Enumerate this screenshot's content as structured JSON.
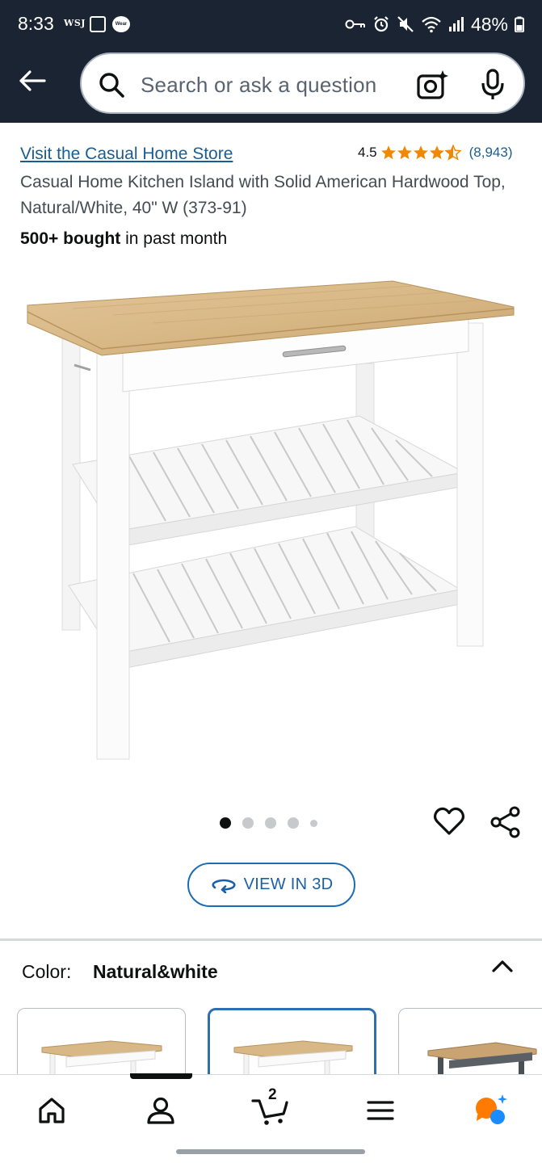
{
  "status_bar": {
    "time": "8:33",
    "app_badge": "WSJ",
    "wear_badge": "Wear",
    "battery": "48%"
  },
  "search": {
    "placeholder": "Search or ask a question"
  },
  "product": {
    "store_link": "Visit the Casual Home Store",
    "rating_value": "4.5",
    "rating_stars": 4.5,
    "rating_count": "(8,943)",
    "title": "Casual Home Kitchen Island with Solid American Hardwood Top, Natural/White, 40\" W (373-91)",
    "bought_bold": "500+ bought",
    "bought_rest": " in past month",
    "image_count": 5,
    "active_image": 1
  },
  "actions": {
    "view_3d_label": "VIEW IN 3D"
  },
  "variation": {
    "label": "Color:",
    "value": "Natural&white"
  },
  "bottom_nav": {
    "cart_count": "2"
  },
  "colors": {
    "header_bg": "#1a2433",
    "link": "#1a5e90",
    "star": "#f08804",
    "accent_blue": "#2d6fb0"
  }
}
